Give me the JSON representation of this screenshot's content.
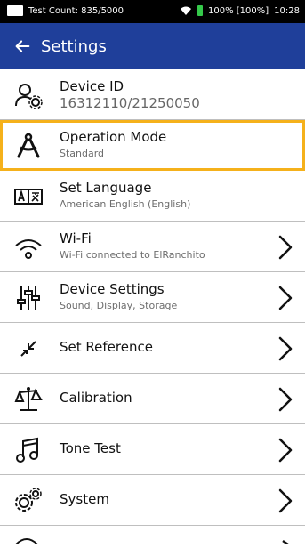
{
  "status": {
    "test_count": "Test Count: 835/5000",
    "battery_text": "100% [100%]",
    "time": "10:28"
  },
  "appbar": {
    "title": "Settings"
  },
  "items": [
    {
      "title": "Device ID",
      "subtitle": "16312110/21250050"
    },
    {
      "title": "Operation Mode",
      "subtitle": "Standard"
    },
    {
      "title": "Set Language",
      "subtitle": "American English (English)"
    },
    {
      "title": "Wi-Fi",
      "subtitle": "Wi-Fi connected to ElRanchito"
    },
    {
      "title": "Device Settings",
      "subtitle": "Sound, Display, Storage"
    },
    {
      "title": "Set Reference"
    },
    {
      "title": "Calibration"
    },
    {
      "title": "Tone Test"
    },
    {
      "title": "System"
    }
  ],
  "colors": {
    "appbar": "#1f3f9a",
    "selection": "#f5b11b",
    "battery": "#35c94a"
  },
  "icons": [
    "back-arrow-icon",
    "user-gear-icon",
    "compass-icon",
    "language-icon",
    "wifi-icon",
    "sliders-icon",
    "reference-arrows-icon",
    "balance-icon",
    "music-note-icon",
    "gears-icon",
    "chevron-right-icon"
  ]
}
